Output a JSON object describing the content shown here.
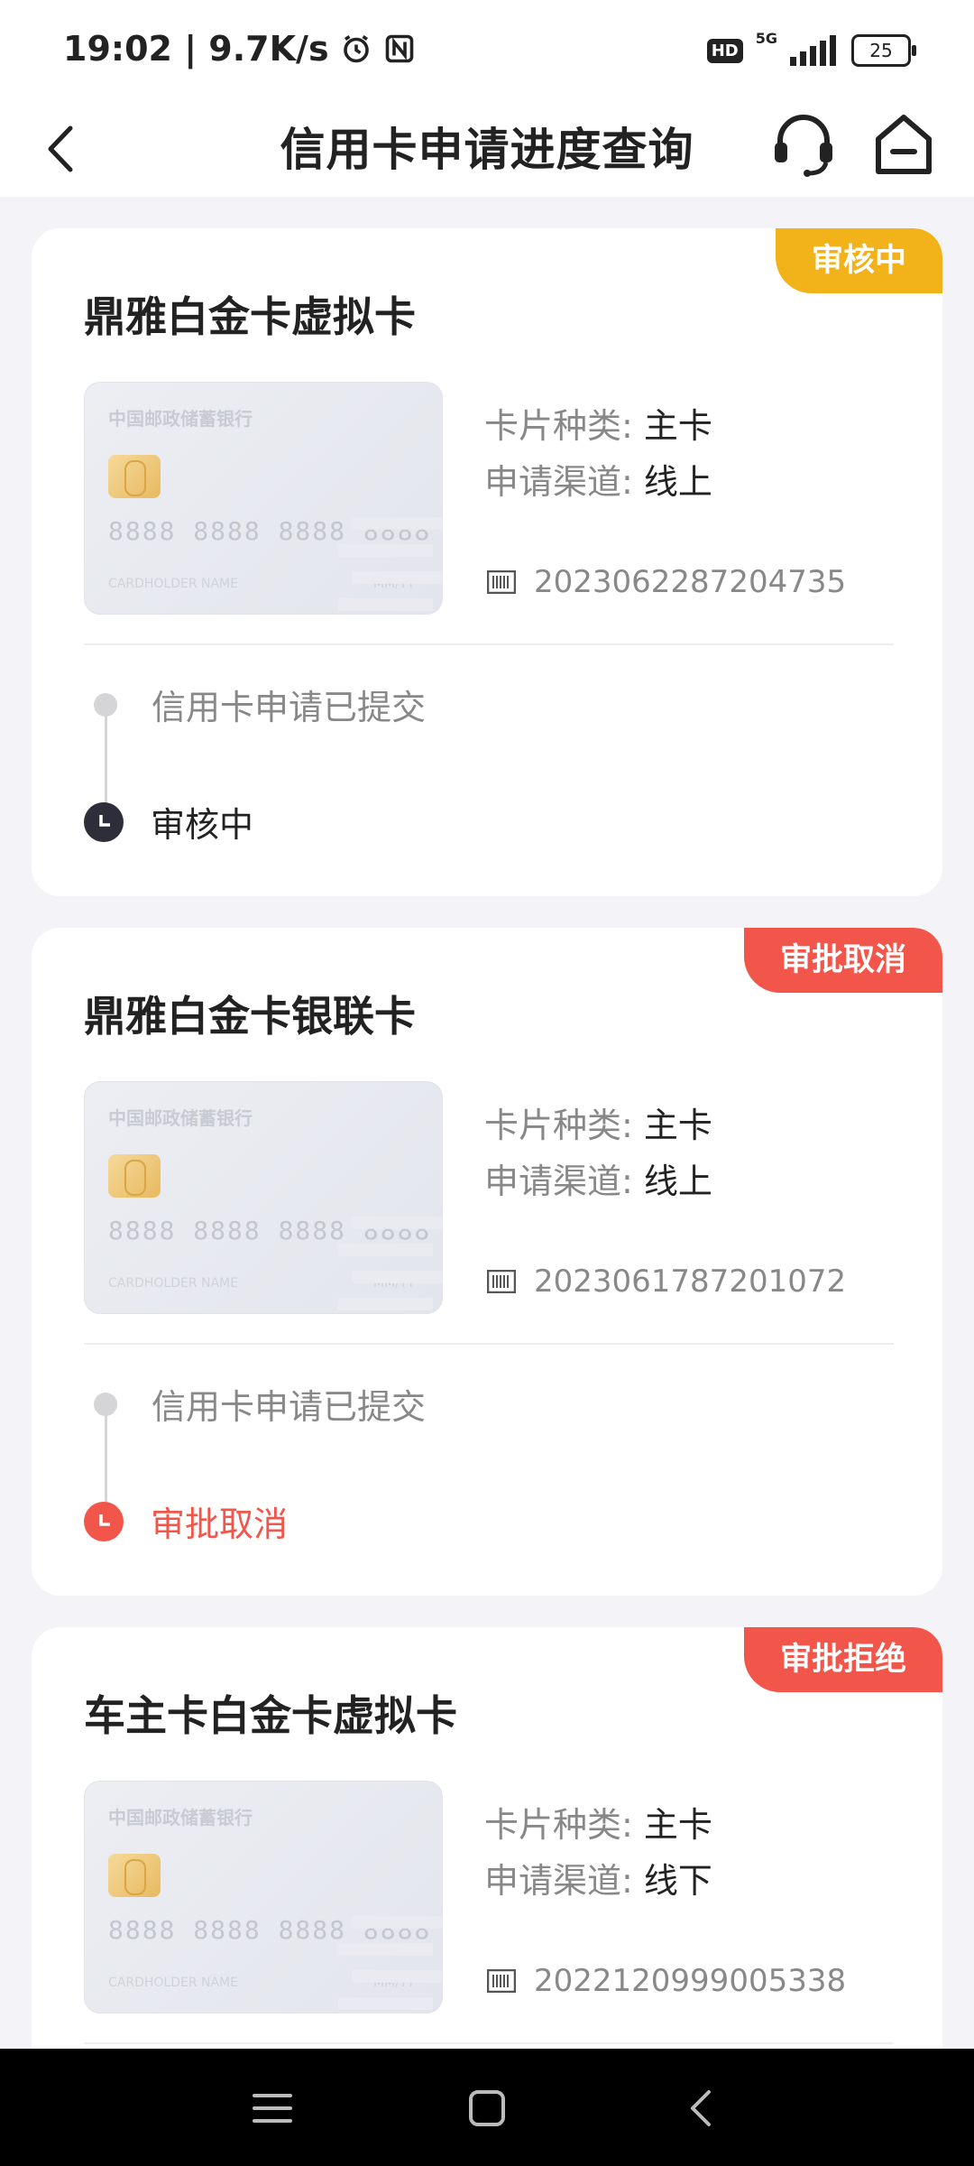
{
  "status_bar": {
    "time_speed": "19:02 | 9.7K/s",
    "hd": "HD",
    "net": "5G",
    "battery": "25"
  },
  "header": {
    "title": "信用卡申请进度查询"
  },
  "labels": {
    "card_type": "卡片种类: ",
    "channel": "申请渠道: "
  },
  "card_face": {
    "bank": "中国邮政储蓄银行",
    "number": "8888 8888 8888 8888",
    "holder": "CARDHOLDER NAME",
    "valid": "MM/YY"
  },
  "applications": [
    {
      "name": "鼎雅白金卡虚拟卡",
      "status": "审核中",
      "card_type": "主卡",
      "channel": "线上",
      "app_no": "2023062287204735",
      "steps": [
        {
          "text": "信用卡申请已提交"
        },
        {
          "text": "审核中"
        }
      ]
    },
    {
      "name": "鼎雅白金卡银联卡",
      "status": "审批取消",
      "card_type": "主卡",
      "channel": "线上",
      "app_no": "2023061787201072",
      "steps": [
        {
          "text": "信用卡申请已提交"
        },
        {
          "text": "审批取消"
        }
      ]
    },
    {
      "name": "车主卡白金卡虚拟卡",
      "status": "审批拒绝",
      "card_type": "主卡",
      "channel": "线下",
      "app_no": "2022120999005338"
    }
  ]
}
